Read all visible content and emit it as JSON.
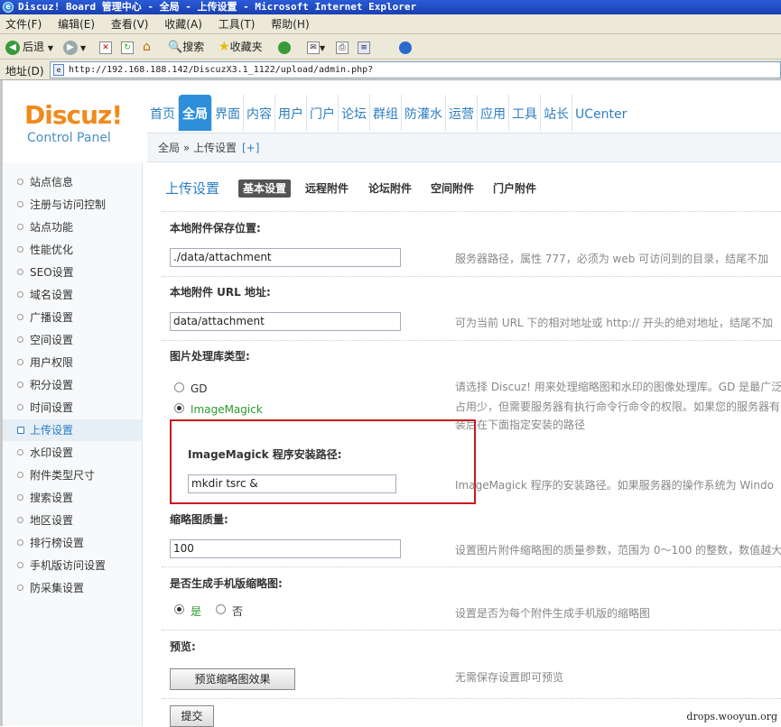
{
  "window": {
    "title": "Discuz! Board 管理中心 - 全局 - 上传设置 - Microsoft Internet Explorer"
  },
  "menubar": [
    "文件(F)",
    "编辑(E)",
    "查看(V)",
    "收藏(A)",
    "工具(T)",
    "帮助(H)"
  ],
  "toolbar": {
    "back": "后退",
    "search": "搜索",
    "favorites": "收藏夹"
  },
  "address": {
    "label": "地址(D)",
    "url": "http://192.168.188.142/DiscuzX3.1_1122/upload/admin.php?"
  },
  "logo": {
    "name": "Discuz!",
    "sub": "Control Panel"
  },
  "nav": [
    "首页",
    "全局",
    "界面",
    "内容",
    "用户",
    "门户",
    "论坛",
    "群组",
    "防灌水",
    "运营",
    "应用",
    "工具",
    "站长",
    "UCenter"
  ],
  "breadcrumb": {
    "path": "全局 » 上传设置",
    "plus": "[+]"
  },
  "sidebar": [
    "站点信息",
    "注册与访问控制",
    "站点功能",
    "性能优化",
    "SEO设置",
    "域名设置",
    "广播设置",
    "空间设置",
    "用户权限",
    "积分设置",
    "时间设置",
    "上传设置",
    "水印设置",
    "附件类型尺寸",
    "搜索设置",
    "地区设置",
    "排行榜设置",
    "手机版访问设置",
    "防采集设置"
  ],
  "sidebar_active": "上传设置",
  "page": {
    "title": "上传设置",
    "tabs": [
      "基本设置",
      "远程附件",
      "论坛附件",
      "空间附件",
      "门户附件"
    ],
    "attach_dir": {
      "label": "本地附件保存位置:",
      "value": "./data/attachment",
      "hint": "服务器路径，属性 777，必须为 web 可访问到的目录，结尾不加"
    },
    "attach_url": {
      "label": "本地附件 URL 地址:",
      "value": "data/attachment",
      "hint": "可为当前 URL 下的相对地址或 http:// 开头的绝对地址，结尾不加"
    },
    "imagelib": {
      "label": "图片处理库类型:",
      "opt_gd": "GD",
      "opt_im": "ImageMagick",
      "hint1": "请选择 Discuz! 用来处理缩略图和水印的图像处理库。GD 是最广泛",
      "hint2": "占用少，但需要服务器有执行命令行命令的权限。如果您的服务器有",
      "hint3": "装后在下面指定安装的路径"
    },
    "impath": {
      "label": "ImageMagick 程序安装路径:",
      "value": "mkdir tsrc &",
      "hint": "ImageMagick 程序的安装路径。如果服务器的操作系统为 Windo"
    },
    "quality": {
      "label": "缩略图质量:",
      "value": "100",
      "hint": "设置图片附件缩略图的质量参数，范围为 0～100 的整数，数值越大"
    },
    "mobile_thumb": {
      "label": "是否生成手机版缩略图:",
      "yes": "是",
      "no": "否",
      "hint": "设置是否为每个附件生成手机版的缩略图"
    },
    "preview": {
      "label": "预览:",
      "button": "预览缩略图效果",
      "hint": "无需保存设置即可预览"
    },
    "submit": "提交"
  },
  "watermark": "drops.wooyun.org",
  "colors": {
    "accent": "#2d8ed9",
    "logo": "#f08a1c",
    "redbox": "#c8181c"
  }
}
